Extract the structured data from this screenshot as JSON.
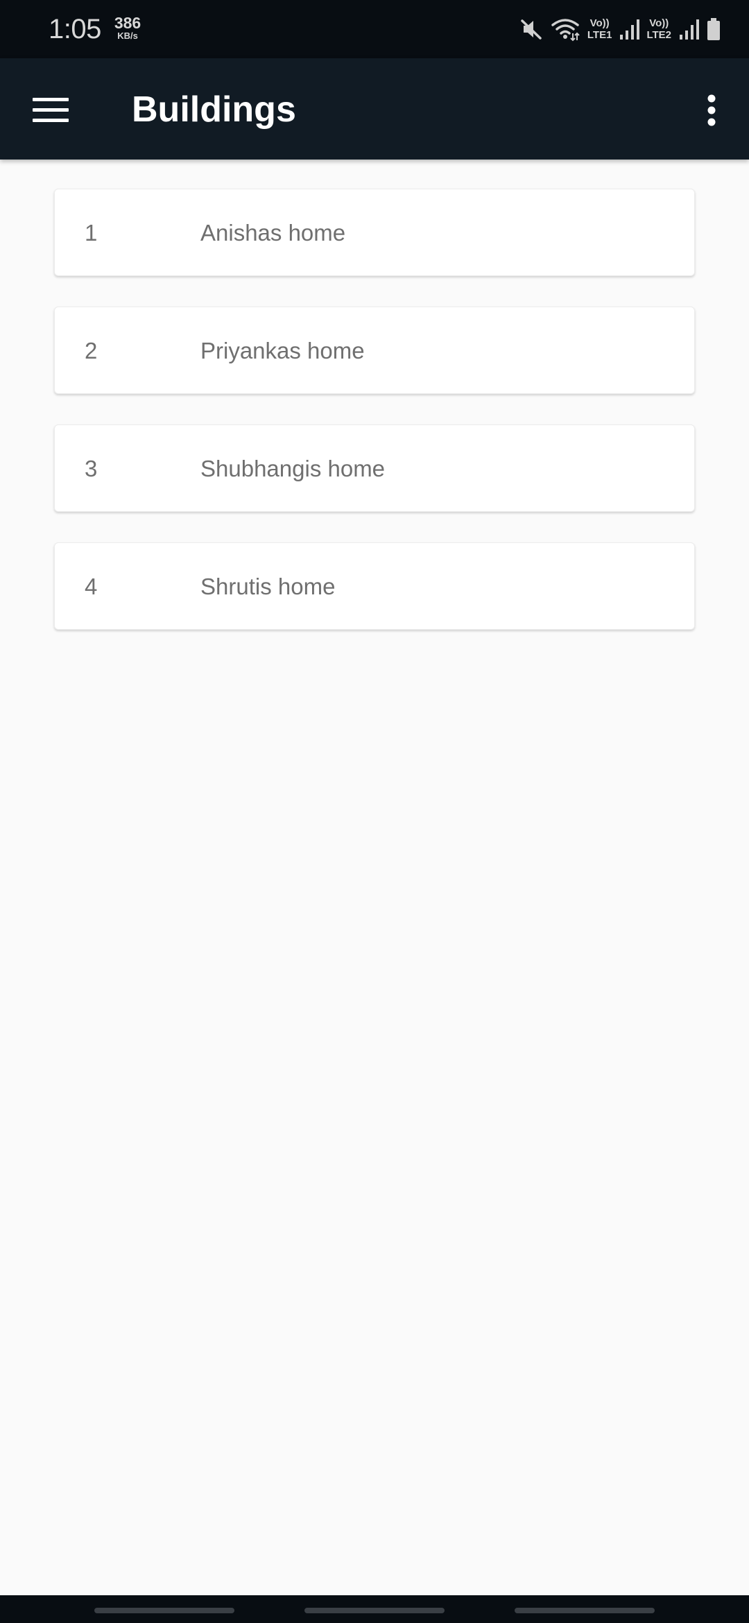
{
  "status_bar": {
    "time": "1:05",
    "net_speed_value": "386",
    "net_speed_unit": "KB/s",
    "sim1_top": "Vo))",
    "sim1_label": "LTE1",
    "sim2_top": "Vo))",
    "sim2_label": "LTE2",
    "icons": [
      "mute-icon",
      "wifi-icon",
      "signal-icon",
      "signal-icon",
      "battery-icon"
    ]
  },
  "app_bar": {
    "title": "Buildings",
    "menu_icon": "hamburger-menu-icon",
    "overflow_icon": "more-vert-icon"
  },
  "buildings": [
    {
      "id": "1",
      "name": "Anishas home"
    },
    {
      "id": "2",
      "name": "Priyankas home"
    },
    {
      "id": "3",
      "name": "Shubhangis home"
    },
    {
      "id": "4",
      "name": "Shrutis home"
    }
  ],
  "colors": {
    "status_bar_bg": "#080d12",
    "app_bar_bg": "#111b24",
    "page_bg": "#fafafa",
    "card_bg": "#ffffff",
    "list_text": "#6f6f6f"
  }
}
